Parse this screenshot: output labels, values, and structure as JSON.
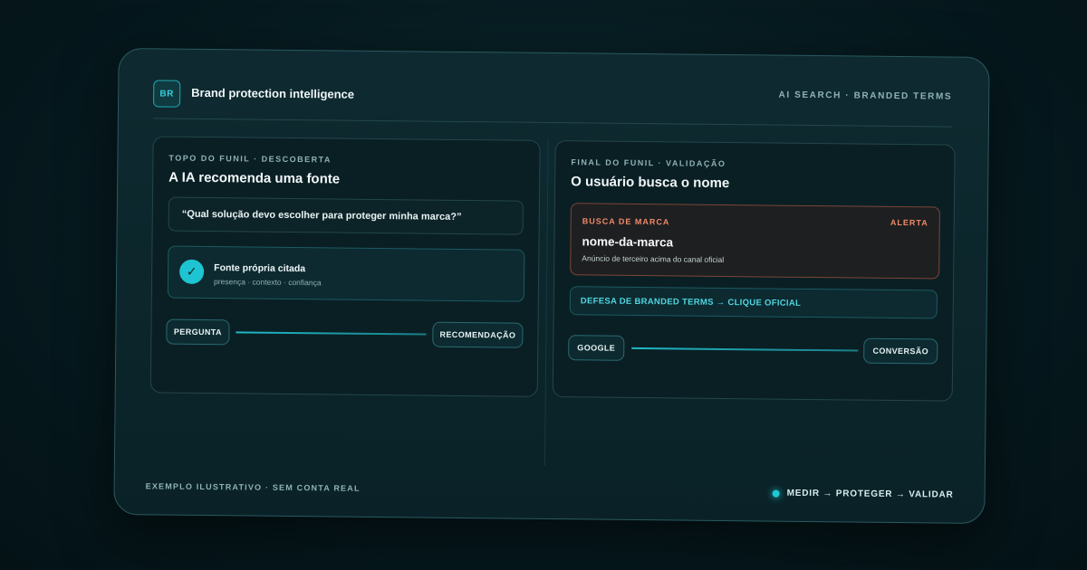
{
  "header": {
    "logo_text": "BR",
    "title": "Brand protection intelligence",
    "tagline": "AI SEARCH · BRANDED TERMS"
  },
  "left_card": {
    "eyebrow": "TOPO DO FUNIL · DESCOBERTA",
    "title": "A IA recomenda uma fonte",
    "quote": "“Qual solução devo escolher para proteger minha marca?”",
    "cited": {
      "icon": "check-icon",
      "title": "Fonte própria citada",
      "subtitle": "presença · contexto · confiança"
    },
    "flow": {
      "start": "PERGUNTA",
      "end": "RECOMENDAÇÃO"
    }
  },
  "right_card": {
    "eyebrow": "FINAL DO FUNIL · VALIDAÇÃO",
    "title": "O usuário busca o nome",
    "alert": {
      "eyebrow": "BUSCA DE MARCA",
      "tag": "ALERTA",
      "term": "nome-da-marca",
      "subtitle": "Anúncio de terceiro acima do canal oficial"
    },
    "defense": "DEFESA DE BRANDED TERMS → CLIQUE OFICIAL",
    "flow": {
      "start": "GOOGLE",
      "end": "CONVERSÃO"
    }
  },
  "footer": {
    "left": "EXEMPLO ILUSTRATIVO · SEM CONTA REAL",
    "right": "MEDIR → PROTEGER → VALIDAR"
  },
  "colors": {
    "accent": "#1ec4d2",
    "alert": "#f08a6a",
    "background": "#061a1f"
  }
}
